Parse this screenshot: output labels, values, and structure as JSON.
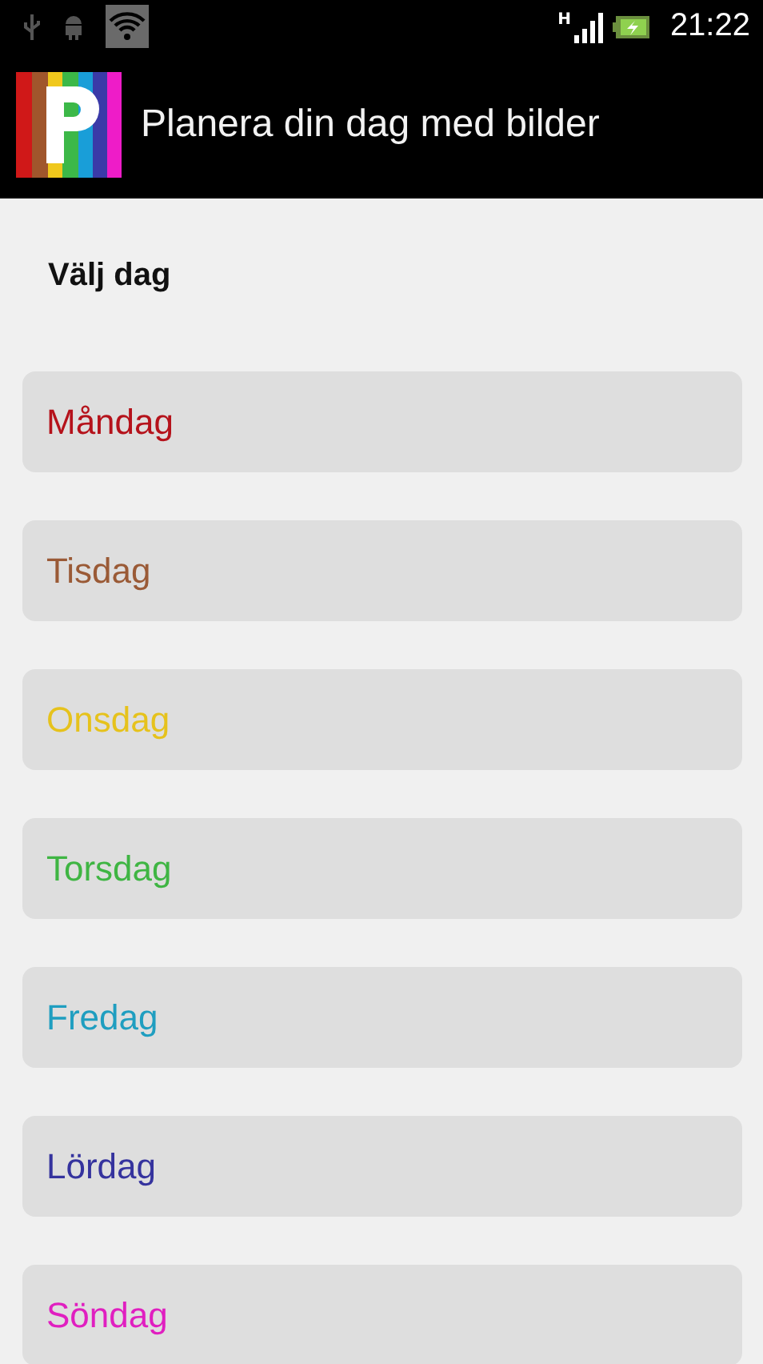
{
  "status_bar": {
    "time": "21:22",
    "network_type": "H"
  },
  "app_bar": {
    "title": "Planera din dag med bilder"
  },
  "heading": "Välj dag",
  "days": [
    {
      "label": "Måndag",
      "color": "#b5121b"
    },
    {
      "label": "Tisdag",
      "color": "#9a5a36"
    },
    {
      "label": "Onsdag",
      "color": "#e6c21c"
    },
    {
      "label": "Torsdag",
      "color": "#3fb543"
    },
    {
      "label": "Fredag",
      "color": "#1f9ec0"
    },
    {
      "label": "Lördag",
      "color": "#35339e"
    },
    {
      "label": "Söndag",
      "color": "#e01fc0"
    }
  ]
}
